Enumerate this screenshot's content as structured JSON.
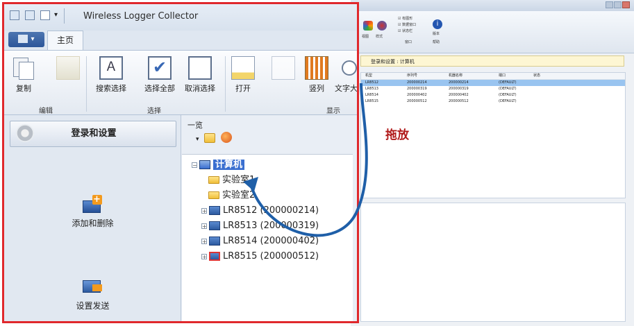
{
  "background_window": {
    "ribbon_labels": [
      "视图",
      "样式",
      "☑ 有图形",
      "☑ 数据窗口",
      "☑ 状态栏",
      "窗口",
      "帮助",
      "版本"
    ],
    "panel_title": "登录和设置 : 计算机",
    "columns": [
      "机型",
      "序列号",
      "机器名称",
      "端口",
      "状态"
    ],
    "rows": [
      {
        "model": "LR8512",
        "serial": "200000214",
        "name": "200000214",
        "port": "(DEFAULT)"
      },
      {
        "model": "LR8513",
        "serial": "200000319",
        "name": "200000319",
        "port": "(DEFAULT)"
      },
      {
        "model": "LR8514",
        "serial": "200000402",
        "name": "200000402",
        "port": "(DEFAULT)"
      },
      {
        "model": "LR8515",
        "serial": "200000512",
        "name": "200000512",
        "port": "(DEFAULT)"
      }
    ]
  },
  "window": {
    "title": "Wireless Logger Collector",
    "file_button": "▾",
    "home_tab": "主页"
  },
  "ribbon": {
    "copy": "复制",
    "group_edit": "编辑",
    "search_select": "搜索选择",
    "select_all": "选择全部",
    "deselect": "取消选择",
    "group_select": "选择",
    "open": "打开",
    "vertical": "竖列",
    "text_size": "文字大",
    "group_display": "显示"
  },
  "nav": {
    "login_settings": "登录和设置",
    "add_delete": "添加和删除",
    "settings_send": "设置发送"
  },
  "tree_pane": {
    "header": "一览",
    "root": "计算机",
    "items": [
      {
        "type": "folder",
        "label": "实验室1"
      },
      {
        "type": "folder",
        "label": "实验室2"
      },
      {
        "type": "device",
        "label": "LR8512 (200000214)"
      },
      {
        "type": "device",
        "label": "LR8513 (200000319)"
      },
      {
        "type": "device",
        "label": "LR8514 (200000402)"
      },
      {
        "type": "device",
        "label": "LR8515 (200000512)"
      }
    ]
  },
  "annotation": {
    "drag_label": "拖放",
    "arrow_color": "#1f5fa8",
    "highlight_color": "#e0282c"
  },
  "icons": [
    "gear-icon",
    "add-device-icon",
    "send-settings-icon",
    "copy-icon",
    "search-select-icon",
    "select-all-icon",
    "deselect-icon",
    "open-icon",
    "vertical-icon",
    "folder-icon",
    "device-icon",
    "computer-icon"
  ]
}
